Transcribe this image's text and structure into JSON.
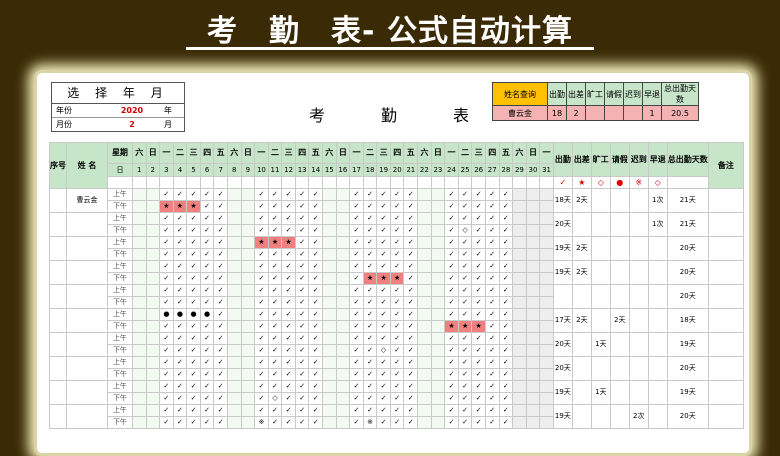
{
  "banner": "考　勤　表- 公式自动计算",
  "ym": {
    "title": "选 择 年 月",
    "year_label": "年份",
    "year": "2020",
    "year_unit": "年",
    "month_label": "月份",
    "month": "2",
    "month_unit": "月"
  },
  "sheet_title": "考　勤　表",
  "query": {
    "label": "姓名查询",
    "headers": [
      "出勤",
      "出差",
      "旷工",
      "请假",
      "迟到",
      "早退",
      "总出勤天数"
    ],
    "name": "曹云金",
    "values": [
      "18",
      "2",
      "",
      "",
      "",
      "1",
      "20.5"
    ]
  },
  "grid": {
    "headers_left": [
      "序号",
      "姓 名",
      "星期"
    ],
    "weekdays": [
      "六",
      "日",
      "一",
      "二",
      "三",
      "四",
      "五",
      "六",
      "日",
      "一",
      "二",
      "三",
      "四",
      "五",
      "六",
      "日",
      "一",
      "二",
      "三",
      "四",
      "五",
      "六",
      "日",
      "一",
      "二",
      "三",
      "四",
      "五",
      "六",
      "日",
      "一"
    ],
    "day_label": "日",
    "days": [
      "1",
      "2",
      "3",
      "4",
      "5",
      "6",
      "7",
      "8",
      "9",
      "10",
      "11",
      "12",
      "13",
      "14",
      "15",
      "16",
      "17",
      "18",
      "19",
      "20",
      "21",
      "22",
      "23",
      "24",
      "25",
      "26",
      "27",
      "28",
      "29",
      "30",
      "31"
    ],
    "summary_headers": [
      "出勤",
      "出差",
      "旷工",
      "请假",
      "迟到",
      "早退",
      "总出勤天数",
      "备注"
    ],
    "legend": [
      "✓",
      "★",
      "◇",
      "●",
      "※",
      "◇"
    ],
    "am": "上午",
    "pm": "下午",
    "check": "✓",
    "rows": [
      {
        "name": "曹云金",
        "am": {},
        "pm": {
          "3": "★",
          "4": "★",
          "5": "★"
        },
        "s": [
          "18天",
          "2天",
          "",
          "",
          "",
          "1次",
          "21天"
        ]
      },
      {
        "name": "",
        "am": {},
        "pm": {
          "25": "◇"
        },
        "s": [
          "20天",
          "",
          "",
          "",
          "",
          "1次",
          "21天"
        ]
      },
      {
        "name": "",
        "am": {
          "10": "★",
          "11": "★",
          "12": "★"
        },
        "pm": {},
        "s": [
          "19天",
          "2天",
          "",
          "",
          "",
          "",
          "20天"
        ]
      },
      {
        "name": "",
        "am": {},
        "pm": {
          "18": "★",
          "19": "★",
          "20": "★"
        },
        "s": [
          "19天",
          "2天",
          "",
          "",
          "",
          "",
          "20天"
        ]
      },
      {
        "name": "",
        "am": {},
        "pm": {},
        "s": [
          "",
          "",
          "",
          "",
          "",
          "",
          "20天"
        ]
      },
      {
        "name": "",
        "am": {
          "3": "●",
          "4": "●",
          "5": "●",
          "6": "●"
        },
        "pm": {
          "24": "★",
          "25": "★",
          "26": "★"
        },
        "s": [
          "17天",
          "2天",
          "",
          "2天",
          "",
          "",
          "18天"
        ]
      },
      {
        "name": "",
        "am": {},
        "pm": {
          "19": "◇"
        },
        "s": [
          "20天",
          "",
          "1天",
          "",
          "",
          "",
          "19天"
        ]
      },
      {
        "name": "",
        "am": {},
        "pm": {},
        "s": [
          "20天",
          "",
          "",
          "",
          "",
          "",
          "20天"
        ]
      },
      {
        "name": "",
        "am": {},
        "pm": {
          "11": "◇"
        },
        "s": [
          "19天",
          "",
          "1天",
          "",
          "",
          "",
          "19天"
        ]
      },
      {
        "name": "",
        "am": {},
        "pm": {
          "10": "※",
          "18": "※"
        },
        "s": [
          "19天",
          "",
          "",
          "",
          "2次",
          "",
          "20天"
        ]
      }
    ]
  }
}
